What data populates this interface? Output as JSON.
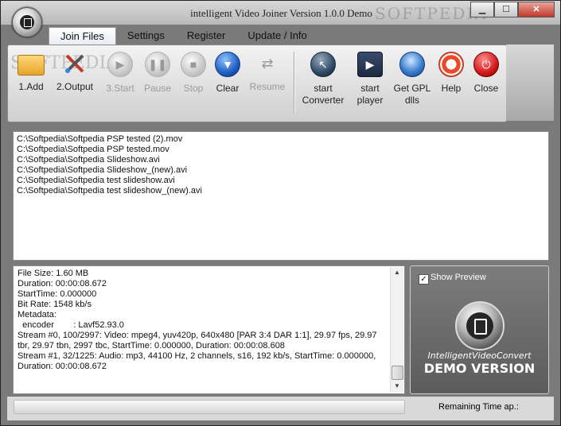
{
  "window": {
    "title": "intelligent Video Joiner Version 1.0.0 Demo",
    "watermark": "SOFTPEDIA",
    "caption_buttons": {
      "minimize": "▁",
      "maximize": "☐",
      "close": "✕"
    }
  },
  "tabs": [
    {
      "label": "Join Files",
      "active": true
    },
    {
      "label": "Settings"
    },
    {
      "label": "Register"
    },
    {
      "label": "Update / Info"
    }
  ],
  "toolbar": {
    "ribbon_watermark": "SOFTPEDIA",
    "add": "1.Add",
    "output": "2.Output",
    "start": "3.Start",
    "pause": "Pause",
    "stop": "Stop",
    "clear": "Clear",
    "resume": "Resume",
    "start_converter": "start Converter",
    "start_player": "start player",
    "get_gpl_dlls": "Get GPL dlls",
    "help": "Help",
    "close": "Close"
  },
  "files": [
    "C:\\Softpedia\\Softpedia PSP tested (2).mov",
    "C:\\Softpedia\\Softpedia PSP tested.mov",
    "C:\\Softpedia\\Softpedia Slideshow.avi",
    "C:\\Softpedia\\Softpedia Slideshow_(new).avi",
    "C:\\Softpedia\\Softpedia test slideshow.avi",
    "C:\\Softpedia\\Softpedia test slideshow_(new).avi"
  ],
  "info_lines": [
    "File Size: 1.60 MB",
    "Duration: 00:00:08.672",
    "StartTime: 0.000000",
    "Bit Rate: 1548 kb/s",
    "Metadata:",
    "  encoder        : Lavf52.93.0",
    "Stream #0, 100/2997: Video: mpeg4, yuv420p, 640x480 [PAR 3:4 DAR 1:1], 29.97 fps, 29.97",
    "tbr, 29.97 tbn, 2997 tbc, StartTime: 0.000000, Duration: 00:00:08.608",
    "Stream #1, 32/1225: Audio: mp3, 44100 Hz, 2 channels, s16, 192 kb/s, StartTime: 0.000000,",
    "Duration: 00:00:08.672"
  ],
  "preview": {
    "show_preview_label": "Show Preview",
    "show_preview_checked": true,
    "checkmark": "✓",
    "brand": "IntelligentVideoConvert",
    "demo": "DEMO VERSION"
  },
  "status": {
    "remaining_label": "Remaining Time ap.:",
    "progress": 0
  },
  "icons": {
    "scroll_up": "▲",
    "scroll_down": "▼"
  }
}
